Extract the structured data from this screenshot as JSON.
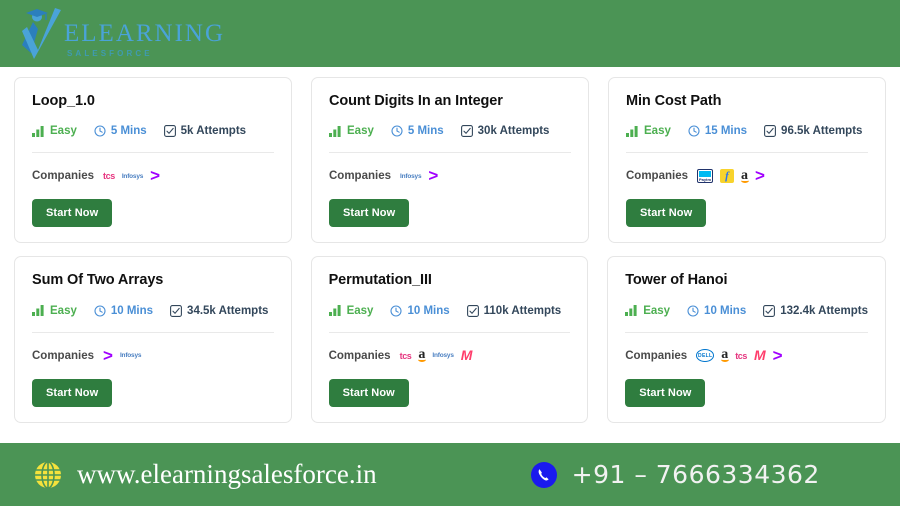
{
  "header": {
    "logo": {
      "icon": "graduate-checkmark-logo",
      "title": "ELEARNING",
      "subtitle": "SALESFORCE"
    },
    "background_color": "#4b9455"
  },
  "labels": {
    "companies": "Companies",
    "start_now": "Start Now"
  },
  "icons": {
    "difficulty": "bar-chart-icon",
    "time": "clock-icon",
    "attempts": "checkbox-icon",
    "globe": "globe-icon",
    "phone": "phone-icon"
  },
  "colors": {
    "brand_green": "#4b9455",
    "button_green": "#2f7d3f",
    "easy_green": "#4caf50",
    "time_blue": "#4a8fd6",
    "attempts_navy": "#33475b",
    "logo_blue": "#4aa3d8",
    "globe_yellow": "#f5e23c",
    "phone_blue": "#1a1aee"
  },
  "cards": [
    {
      "title": "Loop_1.0",
      "difficulty": "Easy",
      "time": "5 Mins",
      "attempts": "5k Attempts",
      "companies": [
        "tcs",
        "infosys",
        "accenture"
      ],
      "start_label": "Start Now"
    },
    {
      "title": "Count Digits In an Integer",
      "difficulty": "Easy",
      "time": "5 Mins",
      "attempts": "30k Attempts",
      "companies": [
        "infosys",
        "accenture"
      ],
      "start_label": "Start Now"
    },
    {
      "title": "Min Cost Path",
      "difficulty": "Easy",
      "time": "15 Mins",
      "attempts": "96.5k Attempts",
      "companies": [
        "paytm",
        "flipkart",
        "amazon",
        "accenture"
      ],
      "start_label": "Start Now"
    },
    {
      "title": "Sum Of Two Arrays",
      "difficulty": "Easy",
      "time": "10 Mins",
      "attempts": "34.5k Attempts",
      "companies": [
        "accenture",
        "infosys"
      ],
      "start_label": "Start Now"
    },
    {
      "title": "Permutation_III",
      "difficulty": "Easy",
      "time": "10 Mins",
      "attempts": "110k Attempts",
      "companies": [
        "tcs",
        "amazon",
        "infosys",
        "myntra"
      ],
      "start_label": "Start Now"
    },
    {
      "title": "Tower of Hanoi",
      "difficulty": "Easy",
      "time": "10 Mins",
      "attempts": "132.4k Attempts",
      "companies": [
        "dell",
        "amazon",
        "tcs",
        "myntra",
        "accenture"
      ],
      "start_label": "Start Now"
    }
  ],
  "footer": {
    "website": "www.elearningsalesforce.in",
    "phone": "+91 – 7666334362",
    "background_color": "#4b9455"
  }
}
